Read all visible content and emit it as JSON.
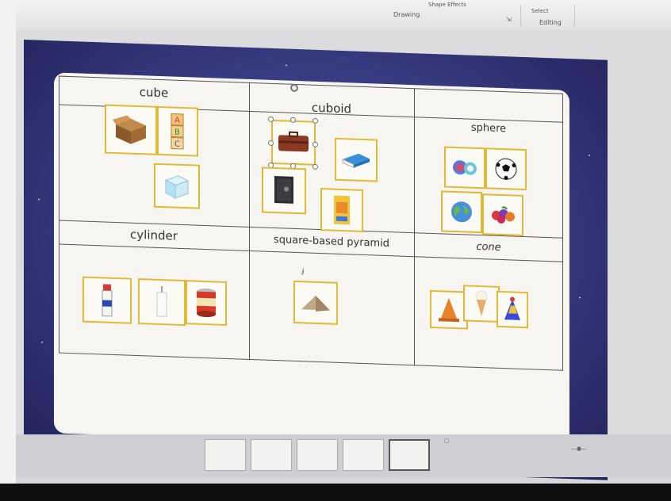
{
  "ribbon": {
    "group_drawing": "Drawing",
    "group_editing": "Editing",
    "shape_effects": "Shape Effects",
    "select": "Select"
  },
  "table": {
    "headers": [
      "cube",
      "cuboid",
      "sphere",
      "cylinder",
      "square-based pyramid",
      "cone"
    ]
  },
  "icons": {
    "cube": [
      "cardboard-box-icon",
      "abc-blocks-icon",
      "ice-cube-icon"
    ],
    "cuboid": [
      "suitcase-icon",
      "book-icon",
      "safe-icon",
      "cereal-box-icon"
    ],
    "sphere": [
      "marbles-icon",
      "football-icon",
      "globe-icon",
      "berries-icon"
    ],
    "cylinder": [
      "glue-stick-icon",
      "candle-icon",
      "tin-can-icon"
    ],
    "pyramid": [
      "pyramid-icon"
    ],
    "cone": [
      "traffic-cone-icon",
      "ice-cream-icon",
      "party-hat-icon"
    ]
  },
  "colors": {
    "tile_border": "#e2b937",
    "slide_background": "#3a3f86",
    "card": "#f6f5f1"
  }
}
